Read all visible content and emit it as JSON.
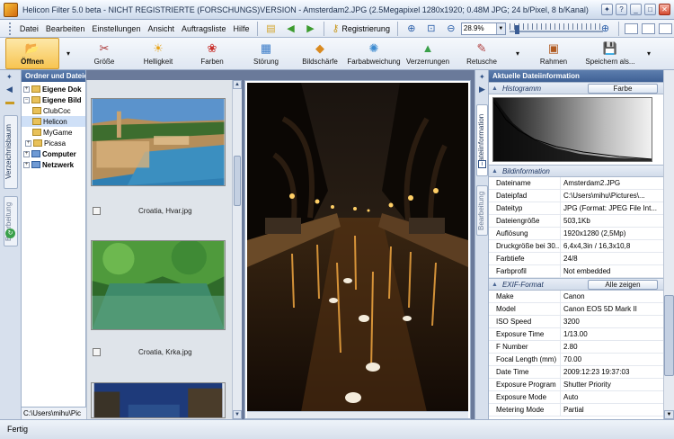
{
  "window": {
    "title": "Helicon Filter 5.0 beta - NICHT REGISTRIERTE (FORSCHUNGS)VERSION - Amsterdam2.JPG (2.5Megapixel 1280x1920; 0.48M JPG; 24 b/Pixel, 8 b/Kanal)"
  },
  "menu": [
    "Datei",
    "Bearbeiten",
    "Einstellungen",
    "Ansicht",
    "Auftragsliste",
    "Hilfe"
  ],
  "quickbar": {
    "register_label": "Registrierung",
    "zoom_value": "28.9%"
  },
  "toolbar": [
    {
      "label": "Öffnen",
      "icon": "open-folder-icon"
    },
    {
      "label": "Größe",
      "icon": "scissors-icon"
    },
    {
      "label": "Helligkeit",
      "icon": "sun-icon"
    },
    {
      "label": "Farben",
      "icon": "palette-icon"
    },
    {
      "label": "Störung",
      "icon": "noise-icon"
    },
    {
      "label": "Bildschärfe",
      "icon": "sharpen-icon"
    },
    {
      "label": "Farbabweichung",
      "icon": "chromatic-icon"
    },
    {
      "label": "Verzerrungen",
      "icon": "distortion-icon"
    },
    {
      "label": "Retusche",
      "icon": "brush-icon"
    },
    {
      "label": "Rahmen",
      "icon": "frame-icon"
    },
    {
      "label": "Speichern als...",
      "icon": "save-icon"
    }
  ],
  "side_tabs": {
    "tree": "Verzeichnisbaum",
    "processing": "Bearbeitung",
    "fileinfo": "Dateiinformation"
  },
  "tree": {
    "title": "Ordner und Dateien",
    "nodes": [
      {
        "label": "Eigene Dok",
        "bold": true
      },
      {
        "label": "Eigene Bild",
        "bold": true
      },
      {
        "label": "ClubCoc",
        "bold": false
      },
      {
        "label": "Helicon",
        "bold": false
      },
      {
        "label": "MyGame",
        "bold": false
      },
      {
        "label": "Picasa",
        "bold": false
      },
      {
        "label": "Computer",
        "bold": true
      },
      {
        "label": "Netzwerk",
        "bold": true
      }
    ],
    "path": "C:\\Users\\mihu\\Pic"
  },
  "thumbnails": [
    {
      "caption": "Croatia, Hvar.jpg"
    },
    {
      "caption": "Croatia, Krka.jpg"
    }
  ],
  "info": {
    "title": "Aktuelle Dateiinformation",
    "histogram_label": "Histogramm",
    "histogram_button": "Farbe",
    "image_info_label": "Bildinformation",
    "image_props": [
      {
        "k": "Dateiname",
        "v": "Amsterdam2.JPG"
      },
      {
        "k": "Dateipfad",
        "v": "C:\\Users\\mihu\\Pictures\\..."
      },
      {
        "k": "Dateityp",
        "v": "JPG (Format: JPEG File Int..."
      },
      {
        "k": "Dateiengröße",
        "v": "503,1Kb"
      },
      {
        "k": "Auflösung",
        "v": "1920x1280 (2,5Mp)"
      },
      {
        "k": "Druckgröße bei 30...",
        "v": "6,4x4,3in / 16,3x10,8"
      },
      {
        "k": "Farbtiefe",
        "v": "24/8"
      },
      {
        "k": "Farbprofil",
        "v": "Not embedded"
      }
    ],
    "exif_label": "EXIF-Format",
    "exif_button": "Alle zeigen",
    "exif_props": [
      {
        "k": "Make",
        "v": "Canon"
      },
      {
        "k": "Model",
        "v": "Canon EOS 5D Mark II"
      },
      {
        "k": "ISO Speed",
        "v": "3200"
      },
      {
        "k": "Exposure Time",
        "v": "1/13.00"
      },
      {
        "k": "F Number",
        "v": "2.80"
      },
      {
        "k": "Focal Length (mm)",
        "v": "70.00"
      },
      {
        "k": "Date Time",
        "v": "2009:12:23 19:37:03"
      },
      {
        "k": "Exposure Program",
        "v": "Shutter Priority"
      },
      {
        "k": "Exposure Mode",
        "v": "Auto"
      },
      {
        "k": "Metering Mode",
        "v": "Partial"
      }
    ]
  },
  "status": "Fertig"
}
